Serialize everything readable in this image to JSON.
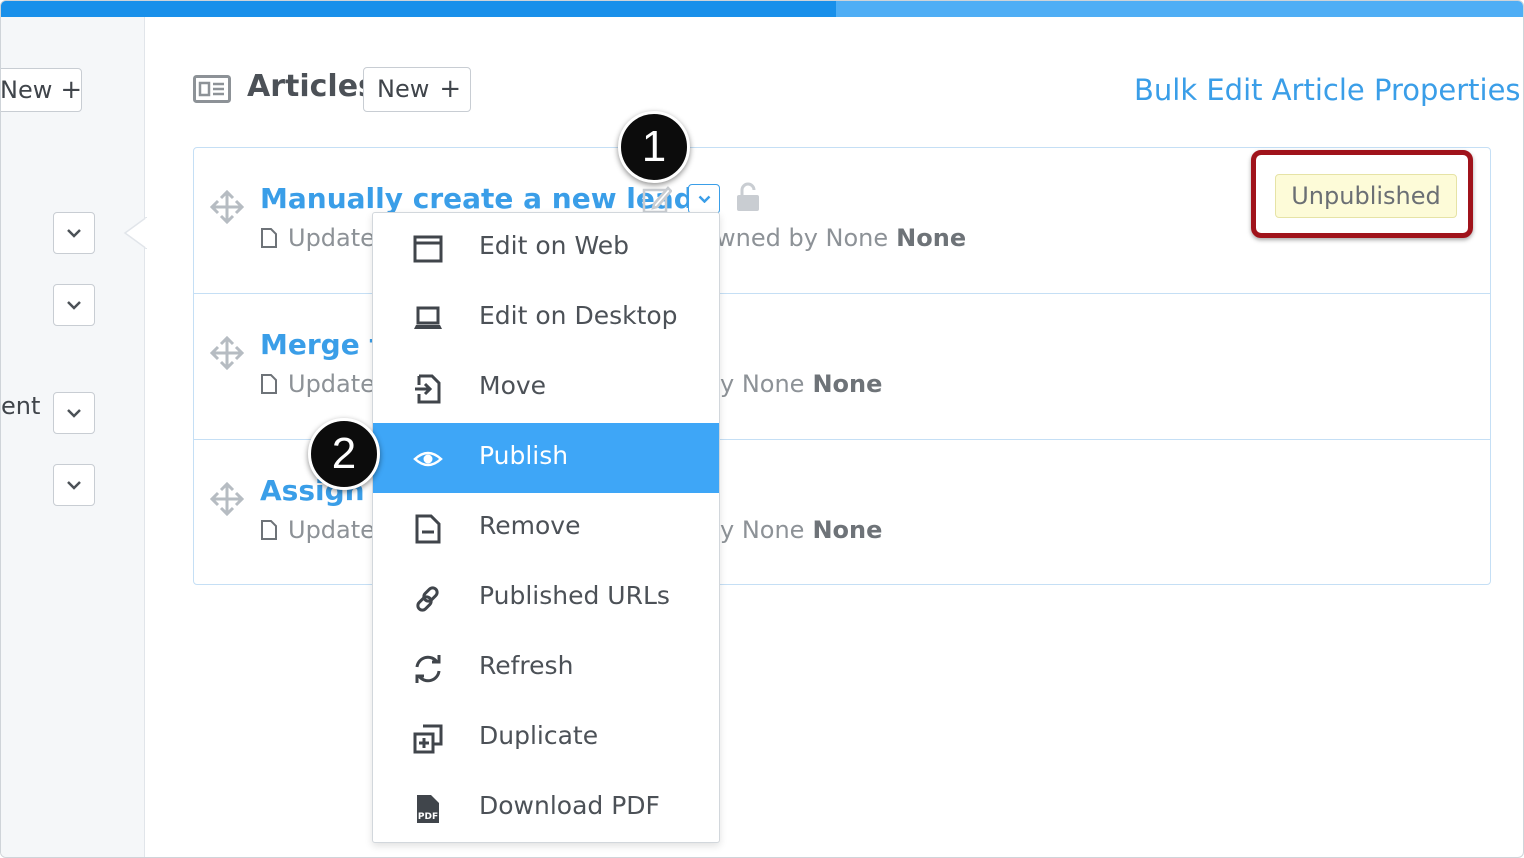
{
  "progress": {
    "fraction": 0.548
  },
  "sidebar": {
    "new_label": "New",
    "plus": "+",
    "partial_text": "ent"
  },
  "header": {
    "title": "Articles",
    "new_label": "New",
    "plus": "+",
    "bulk_edit_label": "Bulk Edit Article Properties"
  },
  "articles": [
    {
      "title": "Manually create a new lead",
      "meta": "Update",
      "owned_prefix": "wned by None",
      "owner": "None",
      "status": "Unpublished"
    },
    {
      "title": "Merge tv",
      "meta": "Update",
      "owned_prefix": "y None",
      "owner": "None"
    },
    {
      "title": "Assign a",
      "meta": "Update",
      "owned_prefix": "y None",
      "owner": "None"
    }
  ],
  "menu": {
    "items": [
      {
        "label": "Edit on Web",
        "icon": "window-icon"
      },
      {
        "label": "Edit on Desktop",
        "icon": "laptop-icon"
      },
      {
        "label": "Move",
        "icon": "move-into-icon"
      },
      {
        "label": "Publish",
        "icon": "eye-icon",
        "active": true
      },
      {
        "label": "Remove",
        "icon": "document-minus-icon"
      },
      {
        "label": "Published URLs",
        "icon": "link-icon"
      },
      {
        "label": "Refresh",
        "icon": "refresh-icon"
      },
      {
        "label": "Duplicate",
        "icon": "duplicate-icon"
      },
      {
        "label": "Download PDF",
        "icon": "pdf-icon",
        "icon_text": "PDF"
      }
    ]
  },
  "callouts": {
    "first": "1",
    "second": "2"
  },
  "colors": {
    "accent": "#3a9ee8",
    "active_menu": "#3ea6f7",
    "highlight_border": "#a0131b",
    "badge_bg": "#fdfbd8"
  }
}
